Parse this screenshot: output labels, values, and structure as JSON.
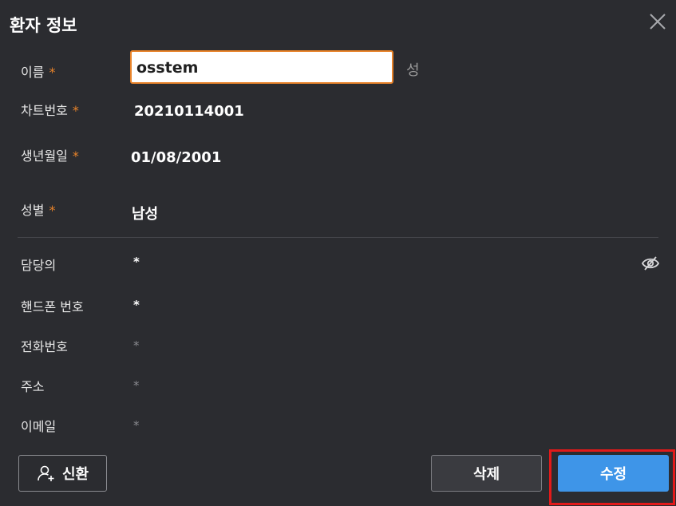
{
  "dialog": {
    "title": "환자 정보"
  },
  "form": {
    "required_mark": "*",
    "name": {
      "label": "이름",
      "value": "osstem",
      "suffix": "성"
    },
    "chart_number": {
      "label": "차트번호",
      "value": "20210114001"
    },
    "birth_date": {
      "label": "생년월일",
      "value": "01/08/2001"
    },
    "gender": {
      "label": "성별",
      "value": "남성"
    },
    "doctor": {
      "label": "담당의",
      "value": "*"
    },
    "mobile": {
      "label": "핸드폰 번호",
      "value": "*"
    },
    "phone": {
      "label": "전화번호",
      "value": "*"
    },
    "address": {
      "label": "주소",
      "value": "*"
    },
    "email": {
      "label": "이메일",
      "value": "*"
    }
  },
  "buttons": {
    "renew": "신환",
    "delete": "삭제",
    "save": "수정"
  },
  "colors": {
    "background": "#2b2c30",
    "accent_orange": "#e8832a",
    "primary_blue": "#3e95e8",
    "highlight_red": "#e21a1a"
  },
  "icons": {
    "close": "close-icon",
    "visibility": "eye-off-icon",
    "add_user": "add-user-icon"
  }
}
